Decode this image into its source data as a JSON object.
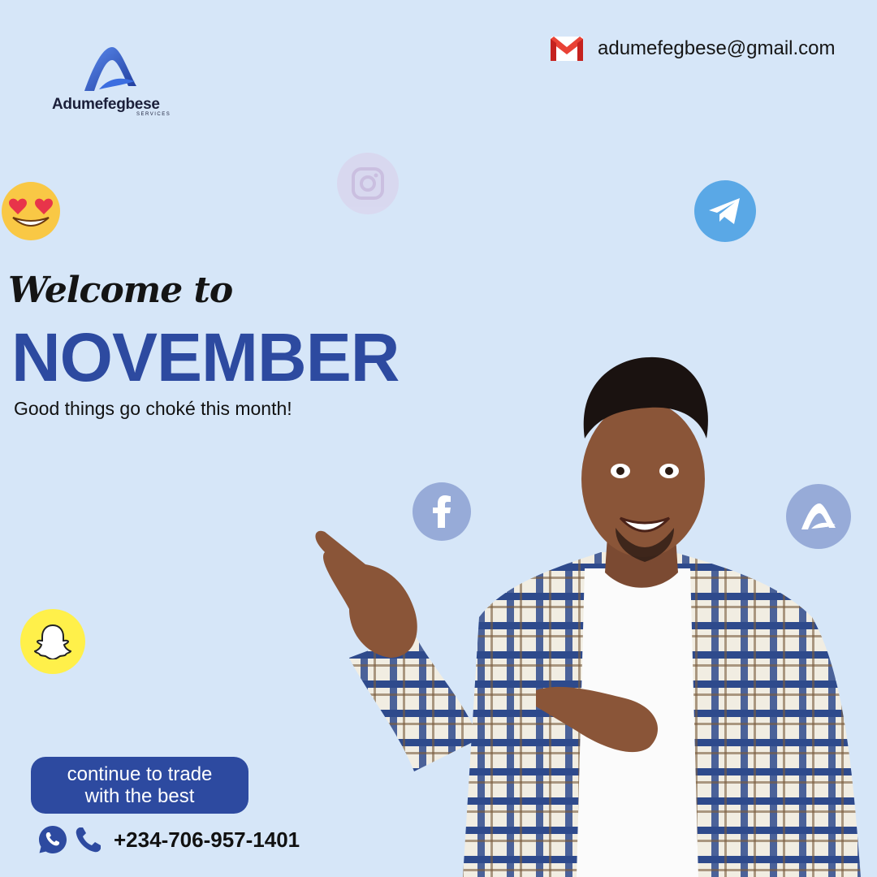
{
  "brand": {
    "name": "Adumefegbese",
    "subtitle": "SERVICES",
    "color": "#2d4aa0"
  },
  "contact": {
    "email": "adumefegbese@gmail.com",
    "phone": "+234-706-957-1401"
  },
  "headline": {
    "script": "Welcome to",
    "month": "NOVEMBER",
    "tagline": "Good things go choké this month!"
  },
  "cta": {
    "line1": "continue to trade",
    "line2": "with the best"
  },
  "icons": [
    "gmail-icon",
    "instagram-icon",
    "telegram-icon",
    "heart-eyes-emoji-icon",
    "facebook-icon",
    "brand-a-icon",
    "snapchat-icon",
    "whatsapp-icon",
    "phone-icon"
  ],
  "colors": {
    "background": "#d6e6f8",
    "accent": "#2d4aa0",
    "telegram": "#5aa8e6",
    "snapchat": "#fff04a"
  }
}
